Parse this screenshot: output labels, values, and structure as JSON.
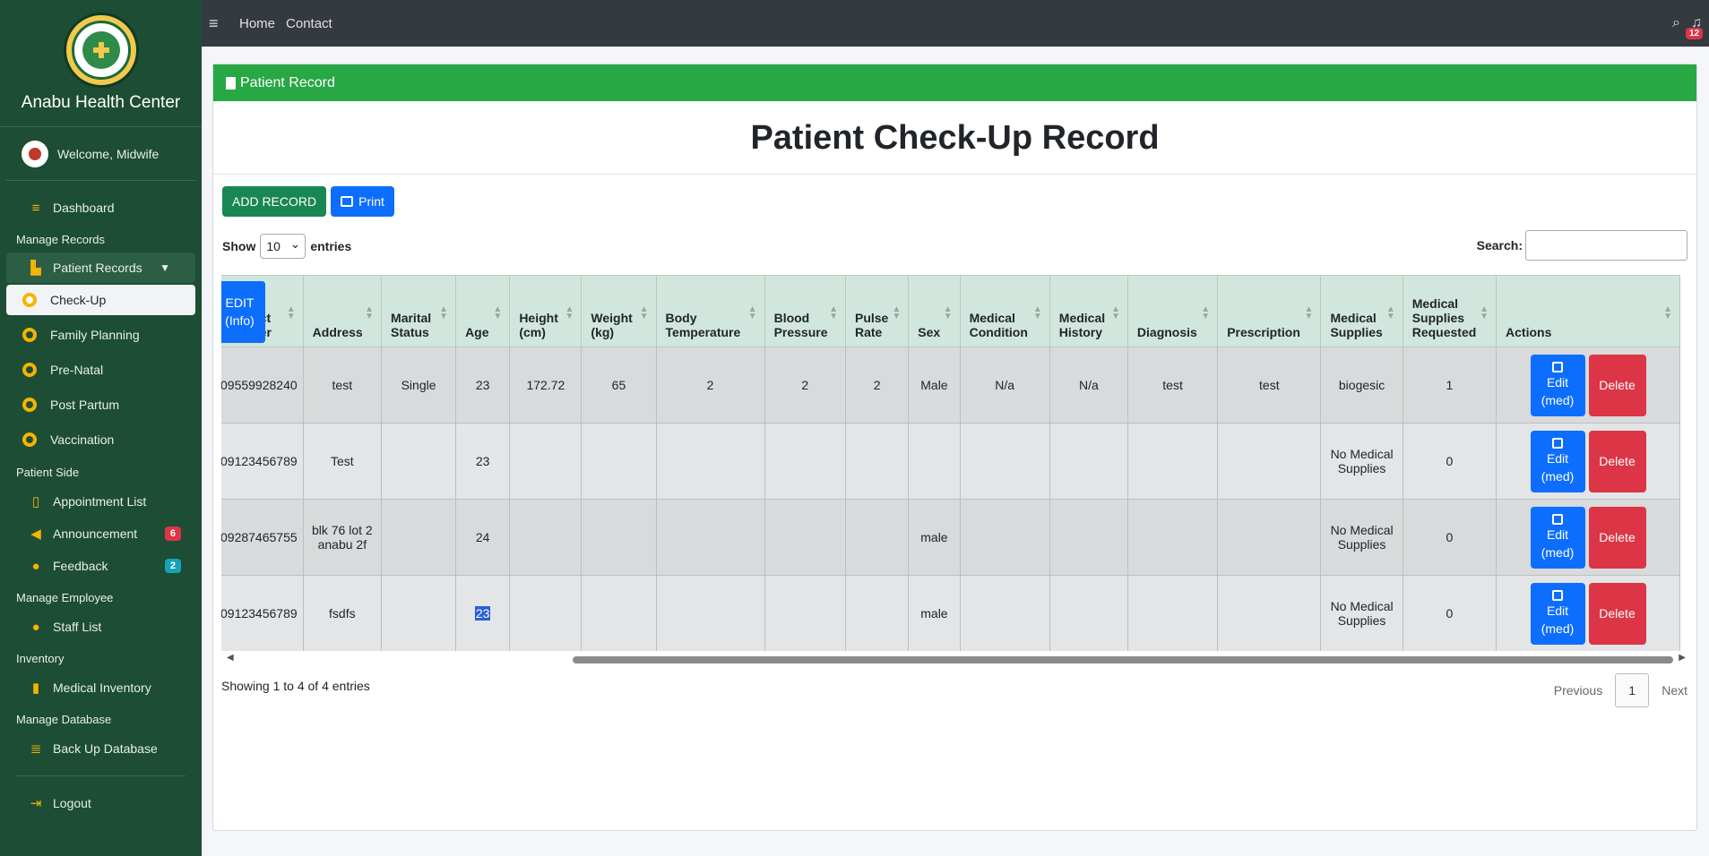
{
  "brand": {
    "name": "Anabu Health Center",
    "logo_text": "ANABU II F HEALTH CENTER"
  },
  "user": {
    "welcome": "Welcome, Midwife"
  },
  "sidebar": {
    "dashboard": "Dashboard",
    "section_manage_records": "Manage Records",
    "patient_records": "Patient Records",
    "sub_items": [
      "Check-Up",
      "Family Planning",
      "Pre-Natal",
      "Post Partum",
      "Vaccination"
    ],
    "section_patient_side": "Patient Side",
    "appointment_list": "Appointment List",
    "announcement": "Announcement",
    "announcement_badge": "6",
    "feedback": "Feedback",
    "feedback_badge": "2",
    "section_manage_employee": "Manage Employee",
    "staff_list": "Staff List",
    "section_inventory": "Inventory",
    "medical_inventory": "Medical Inventory",
    "section_manage_database": "Manage Database",
    "backup_database": "Back Up Database",
    "logout": "Logout"
  },
  "topbar": {
    "home": "Home",
    "contact": "Contact",
    "notification_count": "12"
  },
  "card": {
    "header": "Patient Record",
    "title": "Patient Check-Up Record",
    "add_record": "ADD RECORD",
    "print": "Print"
  },
  "datatable": {
    "show_label": "Show",
    "show_value": "10",
    "entries_label": "entries",
    "search_label": "Search:",
    "info": "Showing 1 to 4 of 4 entries",
    "previous": "Previous",
    "page": "1",
    "next": "Next"
  },
  "table": {
    "headers": [
      "Contact Number",
      "Address",
      "Marital Status",
      "Age",
      "Height (cm)",
      "Weight (kg)",
      "Body Temperature",
      "Blood Pressure",
      "Pulse Rate",
      "Sex",
      "Medical Condition",
      "Medical History",
      "Diagnosis",
      "Prescription",
      "Medical Supplies",
      "Medical Supplies Requested",
      "Actions"
    ],
    "rows": [
      [
        "09559928240",
        "test",
        "Single",
        "23",
        "172.72",
        "65",
        "2",
        "2",
        "2",
        "Male",
        "N/a",
        "N/a",
        "test",
        "test",
        "biogesic",
        "1"
      ],
      [
        "09123456789",
        "Test",
        "",
        "23",
        "",
        "",
        "",
        "",
        "",
        "",
        "",
        "",
        "",
        "",
        "No Medical Supplies",
        "0"
      ],
      [
        "09287465755",
        "blk 76 lot 2 anabu 2f",
        "",
        "24",
        "",
        "",
        "",
        "",
        "",
        "male",
        "",
        "",
        "",
        "",
        "No Medical Supplies",
        "0"
      ],
      [
        "09123456789",
        "fsdfs",
        "",
        "23",
        "",
        "",
        "",
        "",
        "",
        "male",
        "",
        "",
        "",
        "",
        "No Medical Supplies",
        "0"
      ]
    ],
    "actions": {
      "edit_med": "Edit (med)",
      "edit_info": "EDIT (Info)",
      "delete": "Delete"
    }
  }
}
